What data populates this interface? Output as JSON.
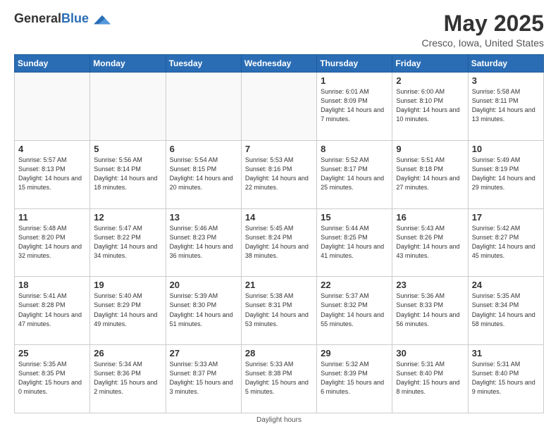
{
  "header": {
    "logo_general": "General",
    "logo_blue": "Blue",
    "month_title": "May 2025",
    "location": "Cresco, Iowa, United States"
  },
  "days_of_week": [
    "Sunday",
    "Monday",
    "Tuesday",
    "Wednesday",
    "Thursday",
    "Friday",
    "Saturday"
  ],
  "footer": {
    "daylight_hours_label": "Daylight hours"
  },
  "weeks": [
    [
      {
        "num": "",
        "sunrise": "",
        "sunset": "",
        "daylight": "",
        "empty": true
      },
      {
        "num": "",
        "sunrise": "",
        "sunset": "",
        "daylight": "",
        "empty": true
      },
      {
        "num": "",
        "sunrise": "",
        "sunset": "",
        "daylight": "",
        "empty": true
      },
      {
        "num": "",
        "sunrise": "",
        "sunset": "",
        "daylight": "",
        "empty": true
      },
      {
        "num": "1",
        "sunrise": "Sunrise: 6:01 AM",
        "sunset": "Sunset: 8:09 PM",
        "daylight": "Daylight: 14 hours and 7 minutes."
      },
      {
        "num": "2",
        "sunrise": "Sunrise: 6:00 AM",
        "sunset": "Sunset: 8:10 PM",
        "daylight": "Daylight: 14 hours and 10 minutes."
      },
      {
        "num": "3",
        "sunrise": "Sunrise: 5:58 AM",
        "sunset": "Sunset: 8:11 PM",
        "daylight": "Daylight: 14 hours and 13 minutes."
      }
    ],
    [
      {
        "num": "4",
        "sunrise": "Sunrise: 5:57 AM",
        "sunset": "Sunset: 8:13 PM",
        "daylight": "Daylight: 14 hours and 15 minutes."
      },
      {
        "num": "5",
        "sunrise": "Sunrise: 5:56 AM",
        "sunset": "Sunset: 8:14 PM",
        "daylight": "Daylight: 14 hours and 18 minutes."
      },
      {
        "num": "6",
        "sunrise": "Sunrise: 5:54 AM",
        "sunset": "Sunset: 8:15 PM",
        "daylight": "Daylight: 14 hours and 20 minutes."
      },
      {
        "num": "7",
        "sunrise": "Sunrise: 5:53 AM",
        "sunset": "Sunset: 8:16 PM",
        "daylight": "Daylight: 14 hours and 22 minutes."
      },
      {
        "num": "8",
        "sunrise": "Sunrise: 5:52 AM",
        "sunset": "Sunset: 8:17 PM",
        "daylight": "Daylight: 14 hours and 25 minutes."
      },
      {
        "num": "9",
        "sunrise": "Sunrise: 5:51 AM",
        "sunset": "Sunset: 8:18 PM",
        "daylight": "Daylight: 14 hours and 27 minutes."
      },
      {
        "num": "10",
        "sunrise": "Sunrise: 5:49 AM",
        "sunset": "Sunset: 8:19 PM",
        "daylight": "Daylight: 14 hours and 29 minutes."
      }
    ],
    [
      {
        "num": "11",
        "sunrise": "Sunrise: 5:48 AM",
        "sunset": "Sunset: 8:20 PM",
        "daylight": "Daylight: 14 hours and 32 minutes."
      },
      {
        "num": "12",
        "sunrise": "Sunrise: 5:47 AM",
        "sunset": "Sunset: 8:22 PM",
        "daylight": "Daylight: 14 hours and 34 minutes."
      },
      {
        "num": "13",
        "sunrise": "Sunrise: 5:46 AM",
        "sunset": "Sunset: 8:23 PM",
        "daylight": "Daylight: 14 hours and 36 minutes."
      },
      {
        "num": "14",
        "sunrise": "Sunrise: 5:45 AM",
        "sunset": "Sunset: 8:24 PM",
        "daylight": "Daylight: 14 hours and 38 minutes."
      },
      {
        "num": "15",
        "sunrise": "Sunrise: 5:44 AM",
        "sunset": "Sunset: 8:25 PM",
        "daylight": "Daylight: 14 hours and 41 minutes."
      },
      {
        "num": "16",
        "sunrise": "Sunrise: 5:43 AM",
        "sunset": "Sunset: 8:26 PM",
        "daylight": "Daylight: 14 hours and 43 minutes."
      },
      {
        "num": "17",
        "sunrise": "Sunrise: 5:42 AM",
        "sunset": "Sunset: 8:27 PM",
        "daylight": "Daylight: 14 hours and 45 minutes."
      }
    ],
    [
      {
        "num": "18",
        "sunrise": "Sunrise: 5:41 AM",
        "sunset": "Sunset: 8:28 PM",
        "daylight": "Daylight: 14 hours and 47 minutes."
      },
      {
        "num": "19",
        "sunrise": "Sunrise: 5:40 AM",
        "sunset": "Sunset: 8:29 PM",
        "daylight": "Daylight: 14 hours and 49 minutes."
      },
      {
        "num": "20",
        "sunrise": "Sunrise: 5:39 AM",
        "sunset": "Sunset: 8:30 PM",
        "daylight": "Daylight: 14 hours and 51 minutes."
      },
      {
        "num": "21",
        "sunrise": "Sunrise: 5:38 AM",
        "sunset": "Sunset: 8:31 PM",
        "daylight": "Daylight: 14 hours and 53 minutes."
      },
      {
        "num": "22",
        "sunrise": "Sunrise: 5:37 AM",
        "sunset": "Sunset: 8:32 PM",
        "daylight": "Daylight: 14 hours and 55 minutes."
      },
      {
        "num": "23",
        "sunrise": "Sunrise: 5:36 AM",
        "sunset": "Sunset: 8:33 PM",
        "daylight": "Daylight: 14 hours and 56 minutes."
      },
      {
        "num": "24",
        "sunrise": "Sunrise: 5:35 AM",
        "sunset": "Sunset: 8:34 PM",
        "daylight": "Daylight: 14 hours and 58 minutes."
      }
    ],
    [
      {
        "num": "25",
        "sunrise": "Sunrise: 5:35 AM",
        "sunset": "Sunset: 8:35 PM",
        "daylight": "Daylight: 15 hours and 0 minutes."
      },
      {
        "num": "26",
        "sunrise": "Sunrise: 5:34 AM",
        "sunset": "Sunset: 8:36 PM",
        "daylight": "Daylight: 15 hours and 2 minutes."
      },
      {
        "num": "27",
        "sunrise": "Sunrise: 5:33 AM",
        "sunset": "Sunset: 8:37 PM",
        "daylight": "Daylight: 15 hours and 3 minutes."
      },
      {
        "num": "28",
        "sunrise": "Sunrise: 5:33 AM",
        "sunset": "Sunset: 8:38 PM",
        "daylight": "Daylight: 15 hours and 5 minutes."
      },
      {
        "num": "29",
        "sunrise": "Sunrise: 5:32 AM",
        "sunset": "Sunset: 8:39 PM",
        "daylight": "Daylight: 15 hours and 6 minutes."
      },
      {
        "num": "30",
        "sunrise": "Sunrise: 5:31 AM",
        "sunset": "Sunset: 8:40 PM",
        "daylight": "Daylight: 15 hours and 8 minutes."
      },
      {
        "num": "31",
        "sunrise": "Sunrise: 5:31 AM",
        "sunset": "Sunset: 8:40 PM",
        "daylight": "Daylight: 15 hours and 9 minutes."
      }
    ]
  ]
}
